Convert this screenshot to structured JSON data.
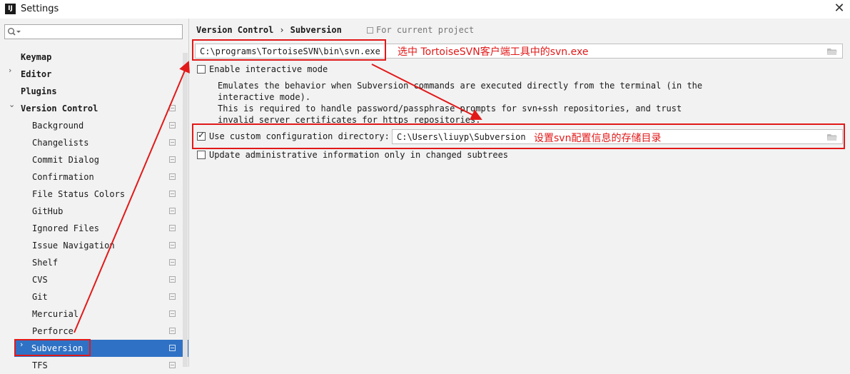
{
  "window": {
    "title": "Settings",
    "app_icon_text": "IJ",
    "close_glyph": "✕"
  },
  "sidebar": {
    "search": {
      "placeholder": "",
      "value": ""
    },
    "items": [
      {
        "label": "Keymap",
        "level": 0,
        "arrow": "",
        "project": false
      },
      {
        "label": "Editor",
        "level": 0,
        "arrow": "›",
        "project": false
      },
      {
        "label": "Plugins",
        "level": 0,
        "arrow": "",
        "project": false
      },
      {
        "label": "Version Control",
        "level": 0,
        "arrow": "⌄",
        "project": true
      },
      {
        "label": "Background",
        "level": 1,
        "project": true
      },
      {
        "label": "Changelists",
        "level": 1,
        "project": true
      },
      {
        "label": "Commit Dialog",
        "level": 1,
        "project": true
      },
      {
        "label": "Confirmation",
        "level": 1,
        "project": true
      },
      {
        "label": "File Status Colors",
        "level": 1,
        "project": true
      },
      {
        "label": "GitHub",
        "level": 1,
        "project": true
      },
      {
        "label": "Ignored Files",
        "level": 1,
        "project": true
      },
      {
        "label": "Issue Navigation",
        "level": 1,
        "project": true
      },
      {
        "label": "Shelf",
        "level": 1,
        "project": true
      },
      {
        "label": "CVS",
        "level": 1,
        "project": true
      },
      {
        "label": "Git",
        "level": 1,
        "project": true
      },
      {
        "label": "Mercurial",
        "level": 1,
        "project": true
      },
      {
        "label": "Perforce",
        "level": 1,
        "project": true
      },
      {
        "label": "Subversion",
        "level": 1,
        "arrow": "›",
        "project": true,
        "selected": true
      },
      {
        "label": "TFS",
        "level": 1,
        "project": true
      }
    ]
  },
  "main": {
    "breadcrumb": {
      "parent": "Version Control",
      "separator": "›",
      "current": "Subversion"
    },
    "scope_label": "For current project",
    "svn_path": {
      "value": "C:\\programs\\TortoiseSVN\\bin\\svn.exe"
    },
    "interactive": {
      "label": "Enable interactive mode",
      "checked": false,
      "description": [
        "Emulates the behavior when Subversion commands are executed directly from the terminal (in the",
        "interactive mode).",
        "This is required to handle password/passphrase prompts for svn+ssh repositories, and trust",
        "invalid server certificates for https repositories."
      ]
    },
    "custom_config": {
      "label": "Use custom configuration directory:",
      "checked": true,
      "value": "C:\\Users\\liuyp\\Subversion"
    },
    "update_admin": {
      "label": "Update administrative information only in changed subtrees",
      "checked": false
    }
  },
  "annotations": {
    "note_svn_exe": "选中 TortoiseSVN客户端工具中的svn.exe",
    "note_config_dir": "设置svn配置信息的存储目录",
    "color": "#e21919"
  },
  "colors": {
    "selection": "#2f72c5",
    "background": "#f2f2f2",
    "annotation": "#e21919"
  }
}
